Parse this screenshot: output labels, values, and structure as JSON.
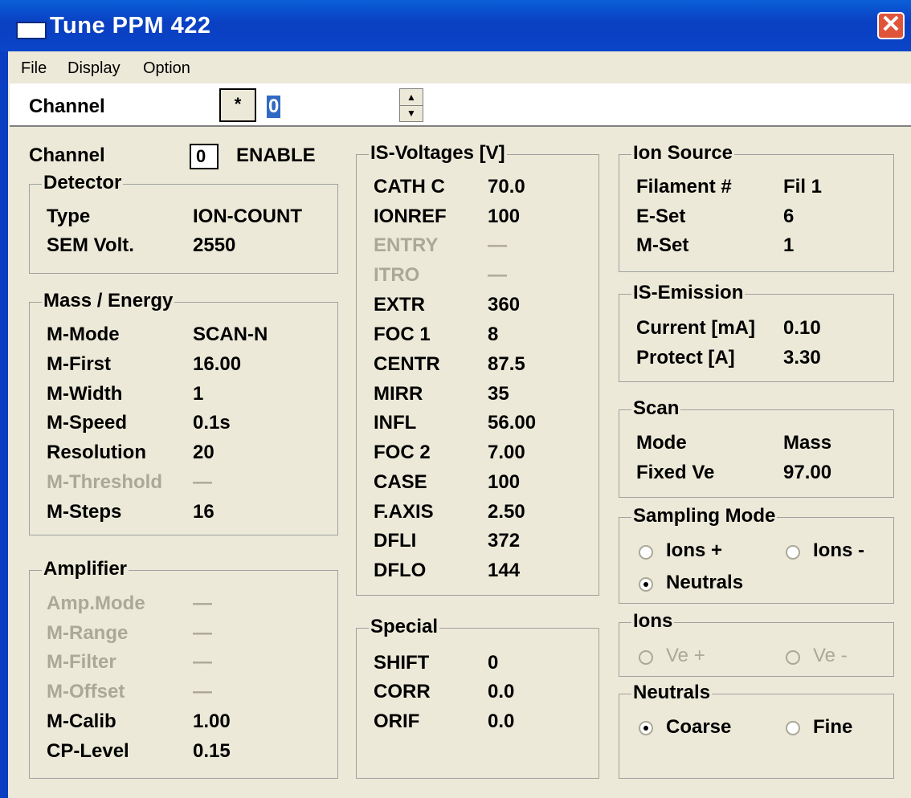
{
  "window": {
    "title": "Tune PPM 422"
  },
  "menu": [
    "File",
    "Display",
    "Option"
  ],
  "toolbar": {
    "channel_label": "Channel",
    "star_label": "*",
    "channel_value": "0"
  },
  "channel_row": {
    "label": "Channel",
    "value": "0",
    "status": "ENABLE"
  },
  "detector": {
    "title": "Detector",
    "rows": [
      {
        "label": "Type",
        "value": "ION-COUNT"
      },
      {
        "label": "SEM Volt.",
        "value": "2550"
      }
    ]
  },
  "mass_energy": {
    "title": "Mass / Energy",
    "rows": [
      {
        "label": "M-Mode",
        "value": "SCAN-N"
      },
      {
        "label": "M-First",
        "value": "16.00"
      },
      {
        "label": "M-Width",
        "value": "1"
      },
      {
        "label": "M-Speed",
        "value": "0.1s"
      },
      {
        "label": "Resolution",
        "value": "20"
      },
      {
        "label": "M-Threshold",
        "value": "—"
      },
      {
        "label": "M-Steps",
        "value": "16"
      }
    ]
  },
  "amplifier": {
    "title": "Amplifier",
    "rows": [
      {
        "label": "Amp.Mode",
        "value": "—"
      },
      {
        "label": "M-Range",
        "value": "—"
      },
      {
        "label": "M-Filter",
        "value": "—"
      },
      {
        "label": "M-Offset",
        "value": "—"
      },
      {
        "label": "M-Calib",
        "value": "1.00"
      },
      {
        "label": "CP-Level",
        "value": "0.15"
      }
    ]
  },
  "is_voltages": {
    "title": "IS-Voltages [V]",
    "rows": [
      {
        "label": "CATH C",
        "value": "70.0"
      },
      {
        "label": "IONREF",
        "value": "100"
      },
      {
        "label": "ENTRY",
        "value": "—"
      },
      {
        "label": "ITRO",
        "value": "—"
      },
      {
        "label": "EXTR",
        "value": "360"
      },
      {
        "label": "FOC 1",
        "value": "8"
      },
      {
        "label": "CENTR",
        "value": "87.5"
      },
      {
        "label": "MIRR",
        "value": "35"
      },
      {
        "label": "INFL",
        "value": "56.00"
      },
      {
        "label": "FOC 2",
        "value": "7.00"
      },
      {
        "label": "CASE",
        "value": "100"
      },
      {
        "label": "F.AXIS",
        "value": "2.50"
      },
      {
        "label": "DFLI",
        "value": "372"
      },
      {
        "label": "DFLO",
        "value": "144"
      }
    ]
  },
  "special": {
    "title": "Special",
    "rows": [
      {
        "label": "SHIFT",
        "value": "0"
      },
      {
        "label": "CORR",
        "value": "0.0"
      },
      {
        "label": "ORIF",
        "value": "0.0"
      }
    ]
  },
  "ion_source": {
    "title": "Ion Source",
    "rows": [
      {
        "label": "Filament #",
        "value": "Fil 1"
      },
      {
        "label": "E-Set",
        "value": "6"
      },
      {
        "label": "M-Set",
        "value": "1"
      }
    ]
  },
  "is_emission": {
    "title": "IS-Emission",
    "rows": [
      {
        "label": "Current [mA]",
        "value": "0.10"
      },
      {
        "label": "Protect [A]",
        "value": "3.30"
      }
    ]
  },
  "scan": {
    "title": "Scan",
    "rows": [
      {
        "label": "Mode",
        "value": "Mass"
      },
      {
        "label": "Fixed Ve",
        "value": "97.00"
      }
    ]
  },
  "sampling_mode": {
    "title": "Sampling Mode",
    "options": [
      "Ions +",
      "Ions -",
      "Neutrals"
    ],
    "selected": "Neutrals"
  },
  "ions": {
    "title": "Ions",
    "options": [
      "Ve +",
      "Ve -"
    ]
  },
  "neutrals": {
    "title": "Neutrals",
    "options": [
      "Coarse",
      "Fine"
    ],
    "selected": "Coarse"
  },
  "colors": {
    "titlebar": "#0a46c8",
    "face": "#ece9d8",
    "disabled_text": "#aca899",
    "selection": "#316ac5"
  }
}
